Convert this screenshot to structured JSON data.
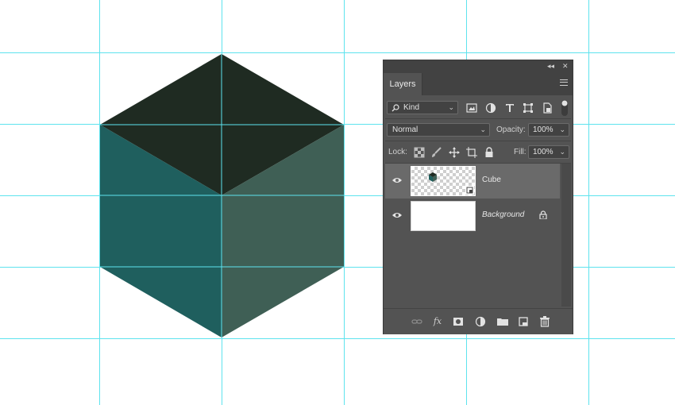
{
  "panel": {
    "tab_label": "Layers",
    "collapse_label": "◂◂",
    "close_label": "✕"
  },
  "filter": {
    "kind_label": "Kind",
    "icons": [
      "image-filter-icon",
      "adjustment-filter-icon",
      "type-filter-icon",
      "shape-filter-icon",
      "smart-object-filter-icon",
      "filter-toggle-icon"
    ]
  },
  "blend": {
    "mode": "Normal",
    "opacity_label": "Opacity:",
    "opacity_value": "100%"
  },
  "lock": {
    "label": "Lock:",
    "fill_label": "Fill:",
    "fill_value": "100%",
    "icons": [
      "lock-transparent-pixels-icon",
      "lock-image-pixels-icon",
      "lock-position-icon",
      "lock-artboard-icon",
      "lock-all-icon"
    ]
  },
  "layers": [
    {
      "name": "Cube",
      "visible": true,
      "selected": true
    },
    {
      "name": "Background",
      "visible": true,
      "selected": false,
      "locked": true
    }
  ],
  "footer": {
    "fx_label": "fx",
    "icons": [
      "link-layers-icon",
      "fx-icon",
      "add-mask-icon",
      "new-adjustment-layer-icon",
      "new-group-icon",
      "new-layer-icon",
      "delete-layer-icon"
    ]
  },
  "colors": {
    "cube_top": "#1f2b22",
    "cube_left": "#1f5f5e",
    "cube_right": "#3f5f55",
    "guide": "#5ee3ee",
    "panel_bg": "#535353",
    "panel_header": "#424242"
  }
}
